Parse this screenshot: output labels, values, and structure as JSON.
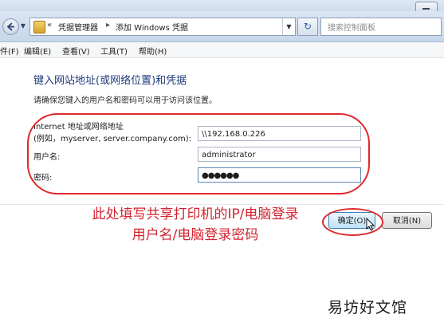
{
  "window": {
    "breadcrumb": [
      "«",
      "凭据管理器",
      "添加 Windows 凭据"
    ],
    "search_placeholder": "搜索控制面板",
    "refresh_icon": "refresh-icon"
  },
  "menu": [
    "件(F)",
    "编辑(E)",
    "查看(V)",
    "工具(T)",
    "帮助(H)"
  ],
  "form": {
    "heading": "键入网站地址(或网络位置)和凭据",
    "description": "请确保您键入的用户名和密码可以用于访问该位置。",
    "address_label_line1": "Internet 地址或网络地址",
    "address_label_line2": "(例如，myserver, server.company.com):",
    "address_value": "\\\\192.168.0.226",
    "username_label": "用户名:",
    "username_value": "administrator",
    "password_label": "密码:",
    "password_value": "●●●●●●"
  },
  "annotation": "此处填写共享打印机的IP/电脑登录用户名/电脑登录密码",
  "buttons": {
    "ok": "确定(O)",
    "cancel": "取消(N)"
  },
  "watermark": "易坊好文馆",
  "colors": {
    "heading": "#1f3a7c",
    "annotation_red": "#e0282c"
  }
}
